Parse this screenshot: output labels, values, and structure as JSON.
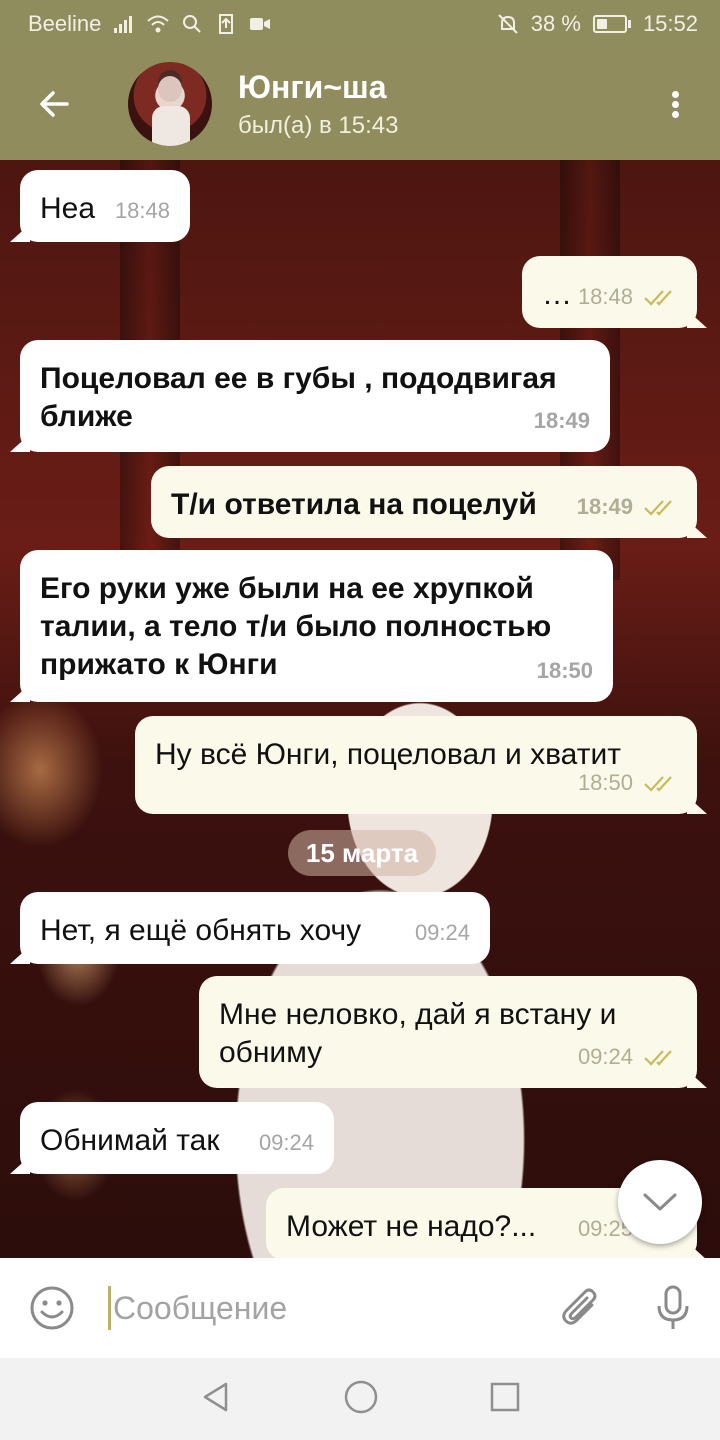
{
  "status_bar": {
    "carrier": "Beeline",
    "battery_percent": "38 %",
    "battery_level": 0.38,
    "time": "15:52"
  },
  "header": {
    "contact_name": "Юнги~ша",
    "last_seen": "был(а) в 15:43",
    "back_icon": "arrow-left-icon",
    "menu_icon": "more-vertical-icon"
  },
  "messages": [
    {
      "dir": "in",
      "text": "Неа",
      "time": "18:48",
      "bold": false
    },
    {
      "dir": "out",
      "text": "…",
      "time": "18:48",
      "bold": false
    },
    {
      "dir": "in",
      "text": "Поцеловал ее в губы , пододвигая ближе",
      "time": "18:49",
      "bold": true
    },
    {
      "dir": "out",
      "text": "Т/и ответила на поцелуй",
      "time": "18:49",
      "bold": true
    },
    {
      "dir": "in",
      "text": "Его руки уже были на ее хрупкой талии, а тело т/и было полностью прижато к Юнги",
      "time": "18:50",
      "bold": true
    },
    {
      "dir": "out",
      "text": "Ну всё Юнги, поцеловал и хватит",
      "time": "18:50",
      "bold": false
    },
    {
      "dir": "in",
      "text": "Нет, я ещё обнять хочу",
      "time": "09:24",
      "bold": false
    },
    {
      "dir": "out",
      "text": "Мне неловко, дай я встану и обниму",
      "time": "09:24",
      "bold": false
    },
    {
      "dir": "in",
      "text": "Обнимай так",
      "time": "09:24",
      "bold": false
    },
    {
      "dir": "out",
      "text": "Может не надо?...",
      "time": "09:25",
      "bold": false
    }
  ],
  "date_divider": "15 марта",
  "input": {
    "placeholder": "Сообщение",
    "emoji_icon": "smile-icon",
    "attach_icon": "paperclip-icon",
    "mic_icon": "microphone-icon"
  },
  "nav": {
    "back_icon": "triangle-back-icon",
    "home_icon": "circle-home-icon",
    "recents_icon": "square-recents-icon"
  },
  "colors": {
    "header_bg": "#908c5e",
    "incoming_bubble": "#ffffff",
    "outgoing_bubble": "#fbf9e9",
    "check_color": "#c8bb5a"
  }
}
